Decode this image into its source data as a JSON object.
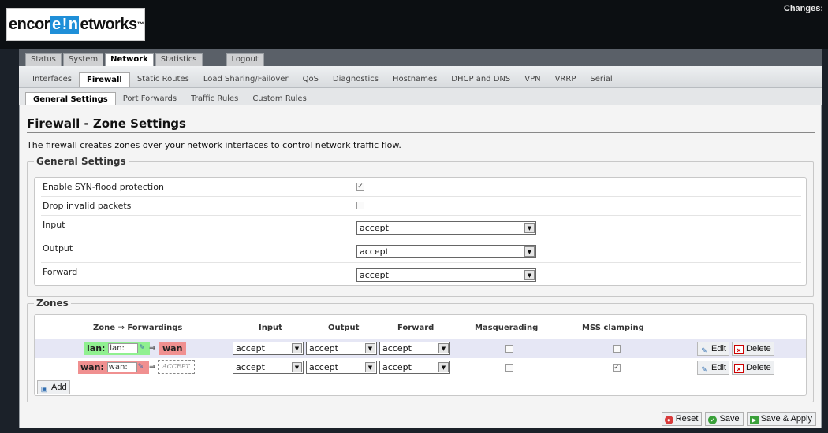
{
  "header": {
    "logo_parts": [
      "encor",
      "e",
      "!",
      "n",
      "etworks"
    ],
    "logo_suffix": "™",
    "changes_label": "Changes:"
  },
  "menu": {
    "primary": [
      "Status",
      "System",
      "Network",
      "Statistics"
    ],
    "primary_active": "Network",
    "logout": "Logout",
    "secondary": [
      "Interfaces",
      "Firewall",
      "Static Routes",
      "Load Sharing/Failover",
      "QoS",
      "Diagnostics",
      "Hostnames",
      "DHCP and DNS",
      "VPN",
      "VRRP",
      "Serial"
    ],
    "secondary_active": "Firewall",
    "tertiary": [
      "General Settings",
      "Port Forwards",
      "Traffic Rules",
      "Custom Rules"
    ],
    "tertiary_active": "General Settings"
  },
  "page": {
    "title": "Firewall - Zone Settings",
    "description": "The firewall creates zones over your network interfaces to control network traffic flow."
  },
  "general": {
    "legend": "General Settings",
    "syn_label": "Enable SYN-flood protection",
    "syn_checked": true,
    "drop_label": "Drop invalid packets",
    "drop_checked": false,
    "input_label": "Input",
    "input_value": "accept",
    "output_label": "Output",
    "output_value": "accept",
    "forward_label": "Forward",
    "forward_value": "accept"
  },
  "zones": {
    "legend": "Zones",
    "headers": {
      "zone": "Zone ⇒ Forwardings",
      "input": "Input",
      "output": "Output",
      "forward": "Forward",
      "masq": "Masquerading",
      "mss": "MSS clamping"
    },
    "rows": [
      {
        "name": "lan:",
        "input_text": "lan:",
        "arrow": "⇒",
        "forward_to": "wan",
        "input": "accept",
        "output": "accept",
        "forward": "accept",
        "masq": false,
        "mss": false,
        "edit": "Edit",
        "delete": "Delete"
      },
      {
        "name": "wan:",
        "input_text": "wan:",
        "arrow": "⇒",
        "forward_to": "ACCEPT",
        "input": "accept",
        "output": "accept",
        "forward": "accept",
        "masq": false,
        "mss": true,
        "edit": "Edit",
        "delete": "Delete"
      }
    ],
    "add": "Add"
  },
  "actions": {
    "reset": "Reset",
    "save": "Save",
    "save_apply": "Save & Apply"
  },
  "colors": {
    "lan_zone": "#90f090",
    "wan_zone": "#f09090",
    "row_highlight": "#e6e7f5"
  }
}
